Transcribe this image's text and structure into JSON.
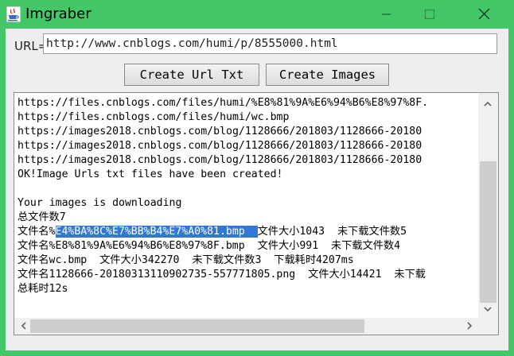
{
  "window": {
    "title": "Imgraber",
    "controls": {
      "minimize": "minimize",
      "maximize": "maximize",
      "close": "close"
    }
  },
  "form": {
    "url_label": "URL=",
    "url_value": "http://www.cnblogs.com/humi/p/8555000.html"
  },
  "toolbar": {
    "create_url_txt_label": "Create Url Txt",
    "create_images_label": "Create Images"
  },
  "log": {
    "lines": [
      {
        "text": "https://files.cnblogs.com/files/humi/%E8%81%9A%E6%94%B6%E8%97%8F."
      },
      {
        "text": "https://files.cnblogs.com/files/humi/wc.bmp"
      },
      {
        "text": "https://images2018.cnblogs.com/blog/1128666/201803/1128666-20180"
      },
      {
        "text": "https://images2018.cnblogs.com/blog/1128666/201803/1128666-20180"
      },
      {
        "text": "https://images2018.cnblogs.com/blog/1128666/201803/1128666-20180"
      },
      {
        "text": "OK!Image Urls txt files have been created!"
      },
      {
        "text": ""
      },
      {
        "text": "Your images is downloading"
      },
      {
        "text": "总文件数7"
      },
      {
        "prefix": "文件名%",
        "selected": "E4%BA%8C%E7%BB%B4%E7%A0%81.bmp  ",
        "suffix": "文件大小1043  未下载文件数5"
      },
      {
        "text": "文件名%E8%81%9A%E6%94%B6%E8%97%8F.bmp  文件大小991  未下载文件数4"
      },
      {
        "text": "文件名wc.bmp  文件大小342270  未下载文件数3  下载耗时4207ms"
      },
      {
        "text": "文件名1128666-20180313110902735-557771805.png  文件大小14421  未下载"
      },
      {
        "text": "总耗时12s"
      }
    ]
  },
  "colors": {
    "titlebar": "#44c769",
    "selection": "#3277d6",
    "panel": "#eeeeee"
  },
  "icons": {
    "app": "java-coffee-cup-icon",
    "scroll_up": "chevron-up-icon",
    "scroll_down": "chevron-down-icon",
    "scroll_left": "chevron-left-icon",
    "scroll_right": "chevron-right-icon"
  }
}
